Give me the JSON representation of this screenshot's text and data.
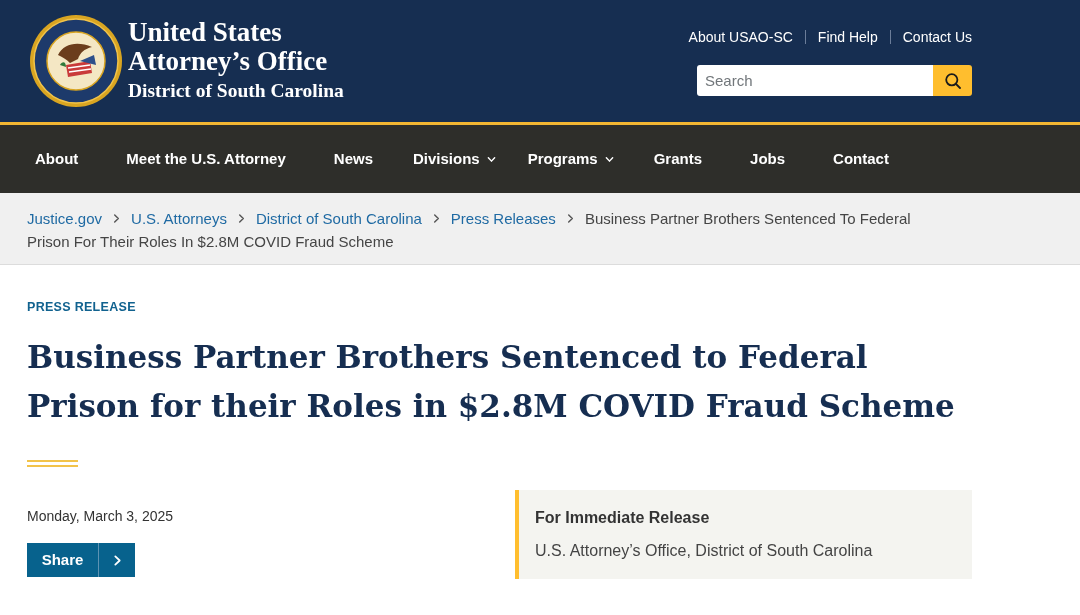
{
  "header": {
    "title_lines": [
      "United States",
      "Attorney’s Office"
    ],
    "subtitle": "District of South Carolina",
    "utility_links": [
      "About USAO-SC",
      "Find Help",
      "Contact Us"
    ],
    "search": {
      "placeholder": "Search"
    }
  },
  "nav": [
    {
      "label": "About",
      "has_menu": false
    },
    {
      "label": "Meet the U.S. Attorney",
      "has_menu": false
    },
    {
      "label": "News",
      "has_menu": false
    },
    {
      "label": "Divisions",
      "has_menu": true
    },
    {
      "label": "Programs",
      "has_menu": true
    },
    {
      "label": "Grants",
      "has_menu": false
    },
    {
      "label": "Jobs",
      "has_menu": false
    },
    {
      "label": "Contact",
      "has_menu": false
    }
  ],
  "breadcrumb": {
    "links": [
      "Justice.gov",
      "U.S. Attorneys",
      "District of South Carolina",
      "Press Releases"
    ],
    "current_lines": [
      "Business Partner Brothers Sentenced To Federal",
      "Prison For Their Roles In $2.8M COVID Fraud Scheme"
    ]
  },
  "article": {
    "label": "PRESS RELEASE",
    "title": "Business Partner Brothers Sentenced to Federal Prison for their Roles in $2.8M COVID Fraud Scheme",
    "date": "Monday, March 3, 2025",
    "share_button": "Share"
  },
  "release_box": {
    "heading": "For Immediate Release",
    "source": "U.S. Attorney’s Office, District of South Carolina"
  }
}
